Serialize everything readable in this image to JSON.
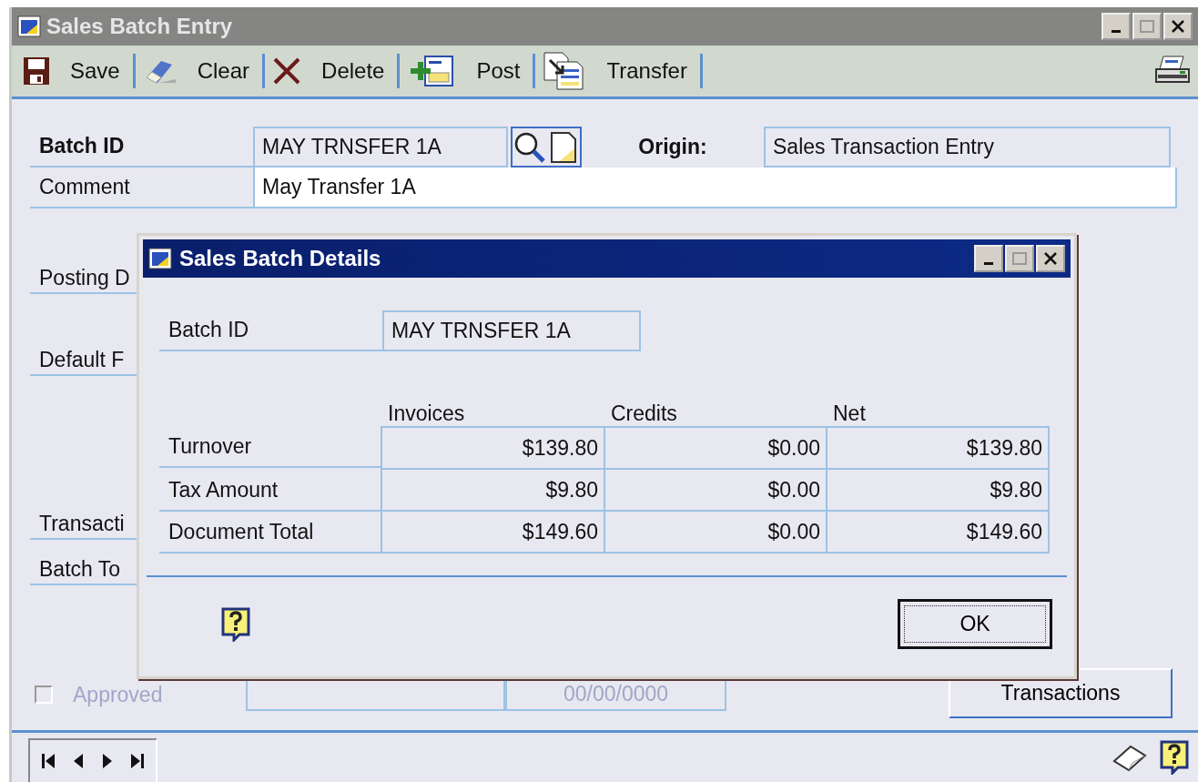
{
  "window": {
    "title": "Sales Batch Entry"
  },
  "toolbar": [
    {
      "label": "Save",
      "kind": "save"
    },
    {
      "label": "Clear",
      "kind": "clear"
    },
    {
      "label": "Delete",
      "kind": "delete"
    },
    {
      "label": "Post",
      "kind": "post"
    },
    {
      "label": "Transfer",
      "kind": "transfer"
    }
  ],
  "form": {
    "batch_id": {
      "label": "Batch ID",
      "value": "MAY TRNSFER 1A"
    },
    "origin": {
      "label": "Origin:",
      "value": "Sales Transaction Entry"
    },
    "comment": {
      "label": "Comment",
      "value": "May Transfer 1A"
    },
    "covered_labels": [
      "Posting D",
      "Default F",
      "Transacti",
      "Batch To"
    ],
    "approved": {
      "label": "Approved",
      "checked": false,
      "disabled": true
    },
    "date": "00/00/0000",
    "transactions_button": "Transactions"
  },
  "dialog": {
    "title": "Sales Batch Details",
    "batch_id": {
      "label": "Batch ID",
      "value": "MAY TRNSFER 1A"
    },
    "columns": [
      "Invoices",
      "Credits",
      "Net"
    ],
    "rows": [
      {
        "label": "Turnover",
        "values": [
          "$139.80",
          "$0.00",
          "$139.80"
        ]
      },
      {
        "label": "Tax Amount",
        "values": [
          "$9.80",
          "$0.00",
          "$9.80"
        ]
      },
      {
        "label": "Document Total",
        "values": [
          "$149.60",
          "$0.00",
          "$149.60"
        ]
      }
    ],
    "ok_button": "OK"
  }
}
